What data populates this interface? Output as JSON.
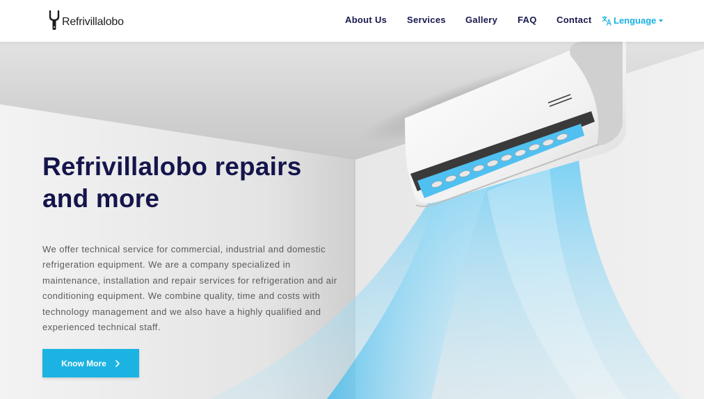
{
  "brand": {
    "name": "Refrivillalobo"
  },
  "nav": {
    "items": [
      {
        "label": "About Us"
      },
      {
        "label": "Services"
      },
      {
        "label": "Gallery"
      },
      {
        "label": "FAQ"
      },
      {
        "label": "Contact"
      }
    ],
    "language": {
      "label": "Lenguage",
      "icon": "translate-icon"
    }
  },
  "hero": {
    "title": "Refrivillalobo repairs and more",
    "description": "We offer technical service for commercial, industrial and domestic refrigeration equipment. We are a company specialized in maintenance, installation and repair services for refrigeration and air conditioning equipment. We combine quality, time and costs with technology management and we also have a highly qualified and experienced technical staff.",
    "cta_label": "Know More",
    "cta_icon": "chevron-right-icon"
  },
  "colors": {
    "accent": "#1cb3e2",
    "heading": "#15154c",
    "body_text": "#5a5a5e",
    "header_bg": "#ffffff"
  }
}
